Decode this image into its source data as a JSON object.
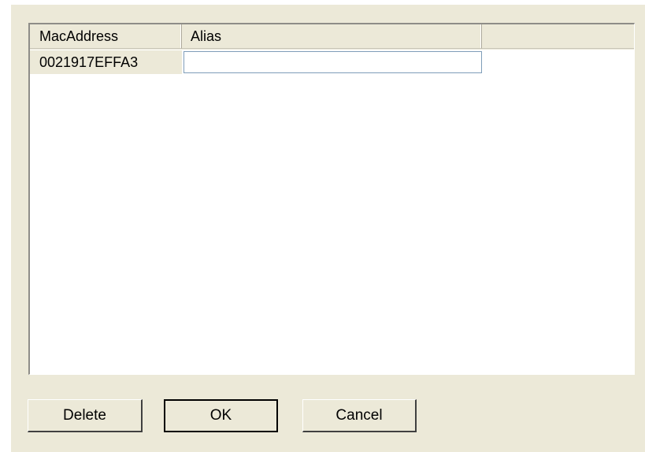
{
  "table": {
    "columns": [
      {
        "label": "MacAddress"
      },
      {
        "label": "Alias"
      }
    ],
    "rows": [
      {
        "mac_address": "0021917EFFA3",
        "alias": ""
      }
    ]
  },
  "buttons": {
    "delete_label": "Delete",
    "ok_label": "OK",
    "cancel_label": "Cancel"
  },
  "colors": {
    "dialog_background": "#ece9d8",
    "list_background": "#ffffff",
    "input_border": "#7f9db9"
  }
}
